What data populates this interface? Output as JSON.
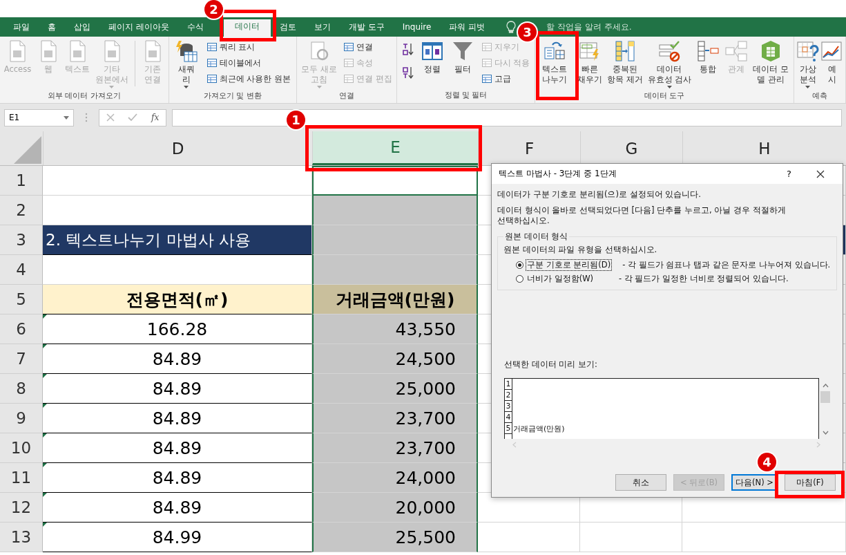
{
  "tabs": [
    {
      "label": "파일",
      "selected": false
    },
    {
      "label": "홈",
      "selected": false
    },
    {
      "label": "삽입",
      "selected": false
    },
    {
      "label": "페이지 레이아웃",
      "selected": false
    },
    {
      "label": "수식",
      "selected": false
    },
    {
      "label": "데이터",
      "selected": true
    },
    {
      "label": "검토",
      "selected": false
    },
    {
      "label": "보기",
      "selected": false
    },
    {
      "label": "개발 도구",
      "selected": false
    },
    {
      "label": "Inquire",
      "selected": false
    },
    {
      "label": "파워 피벗",
      "selected": false
    }
  ],
  "tell_me": "할 작업을 알려 주세요.",
  "ribbon": [
    {
      "label": "외부 데이터 가져오기",
      "items": [
        {
          "kind": "big",
          "lines": [
            "Access"
          ],
          "disabled": true,
          "dropdown": false
        },
        {
          "kind": "big",
          "lines": [
            "웹"
          ],
          "disabled": true,
          "dropdown": false
        },
        {
          "kind": "big",
          "lines": [
            "텍스트"
          ],
          "disabled": true,
          "dropdown": false
        },
        {
          "kind": "big",
          "lines": [
            "기타",
            "원본에서"
          ],
          "disabled": true,
          "dropdown": true
        },
        {
          "kind": "divider"
        },
        {
          "kind": "big",
          "lines": [
            "기존",
            "연결"
          ],
          "disabled": true,
          "dropdown": false
        }
      ]
    },
    {
      "label": "가져오기 및 변환",
      "items": [
        {
          "kind": "big",
          "lines": [
            "새쿼",
            "리"
          ],
          "disabled": false,
          "dropdown": true
        },
        {
          "kind": "stack",
          "items": [
            {
              "label": "쿼리 표시",
              "disabled": false
            },
            {
              "label": "테이블에서",
              "disabled": false
            },
            {
              "label": "최근에 사용한 원본",
              "disabled": false
            }
          ]
        }
      ]
    },
    {
      "label": "연결",
      "items": [
        {
          "kind": "big",
          "lines": [
            "모두 새로",
            "고침"
          ],
          "disabled": true,
          "dropdown": true
        },
        {
          "kind": "stack",
          "items": [
            {
              "label": "연결",
              "disabled": false
            },
            {
              "label": "속성",
              "disabled": true
            },
            {
              "label": "연결 편집",
              "disabled": true
            }
          ]
        }
      ]
    },
    {
      "label": "정렬 및 필터",
      "items": [
        {
          "kind": "sort"
        },
        {
          "kind": "big",
          "lines": [
            "정렬"
          ],
          "disabled": false,
          "dropdown": false
        },
        {
          "kind": "big",
          "lines": [
            "필터"
          ],
          "disabled": false,
          "dropdown": false
        },
        {
          "kind": "stack",
          "items": [
            {
              "label": "지우기",
              "disabled": true
            },
            {
              "label": "다시 적용",
              "disabled": true
            },
            {
              "label": "고급",
              "disabled": false
            }
          ]
        }
      ]
    },
    {
      "label": "데이터 도구",
      "items": [
        {
          "kind": "big",
          "lines": [
            "텍스트",
            "나누기"
          ],
          "disabled": false,
          "dropdown": false
        },
        {
          "kind": "big",
          "lines": [
            "빠른",
            "채우기"
          ],
          "disabled": false,
          "dropdown": false
        },
        {
          "kind": "big",
          "lines": [
            "중복된",
            "항목 제거"
          ],
          "disabled": false,
          "dropdown": false
        },
        {
          "kind": "big",
          "lines": [
            "데이터",
            "유효성 검사"
          ],
          "disabled": false,
          "dropdown": true
        },
        {
          "kind": "big",
          "lines": [
            "통합"
          ],
          "disabled": false,
          "dropdown": false
        },
        {
          "kind": "big",
          "lines": [
            "관계"
          ],
          "disabled": true,
          "dropdown": false
        },
        {
          "kind": "big",
          "lines": [
            "데이터 모",
            "델 관리"
          ],
          "disabled": false,
          "dropdown": false
        }
      ]
    },
    {
      "label": "예측",
      "items": [
        {
          "kind": "big",
          "lines": [
            "가상",
            "분석"
          ],
          "disabled": false,
          "dropdown": true
        },
        {
          "kind": "big",
          "lines": [
            "예",
            "시"
          ],
          "disabled": false,
          "dropdown": false
        }
      ]
    }
  ],
  "name_box": "E1",
  "formula_fx": "fx",
  "columns": [
    {
      "label": "D",
      "selected": false
    },
    {
      "label": "E",
      "selected": true
    },
    {
      "label": "F",
      "selected": false
    },
    {
      "label": "G",
      "selected": false
    },
    {
      "label": "H",
      "selected": false
    }
  ],
  "rows": [
    {
      "number": "1",
      "kind": "blank",
      "active": true,
      "selected": true,
      "flag": false
    },
    {
      "number": "2",
      "kind": "blank",
      "active": false,
      "selected": true,
      "flag": false
    },
    {
      "number": "3",
      "kind": "title",
      "d": "2. 텍스트나누기 마법사 사용",
      "active": false,
      "selected": true,
      "flag": false
    },
    {
      "number": "4",
      "kind": "blank",
      "active": false,
      "selected": true,
      "flag": false
    },
    {
      "number": "5",
      "kind": "header",
      "d": "전용면적(㎡)",
      "e": "거래금액(만원)",
      "active": false,
      "selected": true,
      "flag": false
    },
    {
      "number": "6",
      "kind": "data",
      "d": "166.28",
      "e": "43,550",
      "active": false,
      "selected": true,
      "flag": true
    },
    {
      "number": "7",
      "kind": "data",
      "d": "84.89",
      "e": "24,500",
      "active": false,
      "selected": true,
      "flag": true
    },
    {
      "number": "8",
      "kind": "data",
      "d": "84.89",
      "e": "25,000",
      "active": false,
      "selected": true,
      "flag": true
    },
    {
      "number": "9",
      "kind": "data",
      "d": "84.89",
      "e": "23,700",
      "active": false,
      "selected": true,
      "flag": true
    },
    {
      "number": "10",
      "kind": "data",
      "d": "84.89",
      "e": "23,700",
      "active": false,
      "selected": true,
      "flag": true
    },
    {
      "number": "11",
      "kind": "data",
      "d": "84.89",
      "e": "24,000",
      "active": false,
      "selected": true,
      "flag": true
    },
    {
      "number": "12",
      "kind": "data",
      "d": "84.89",
      "e": "20,000",
      "active": false,
      "selected": true,
      "flag": true
    },
    {
      "number": "13",
      "kind": "data",
      "d": "84.99",
      "e": "25,500",
      "active": false,
      "selected": true,
      "flag": true
    }
  ],
  "dialog": {
    "title": "텍스트 마법사 - 3단계 중 1단계",
    "help": "?",
    "message": "데이터가 구분 기호로 분리됨(으)로 설정되어 있습니다.",
    "instruction": "데이터 형식이 올바로 선택되었다면 [다음] 단추를 누르고, 아닐 경우 적절하게 선택하십시오.",
    "group_label": "원본 데이터 형식",
    "prompt": "원본 데이터의 파일 유형을 선택하십시오.",
    "options": [
      {
        "label": "구분 기호로 분리됨(D)",
        "description": "- 각 필드가 쉼표나 탭과 같은 문자로 나누어져 있습니다.",
        "selected": true
      },
      {
        "label": "너비가 일정함(W)",
        "description": "- 각 필드가 일정한 너비로 정렬되어 있습니다.",
        "selected": false
      }
    ],
    "preview_label": "선택한 데이터 미리 보기:",
    "preview_rows": [
      {
        "n": "1"
      },
      {
        "n": "2"
      },
      {
        "n": "3"
      },
      {
        "n": "4"
      },
      {
        "n": "5",
        "text": "거래금액(만원)"
      }
    ],
    "buttons": [
      {
        "label": "취소",
        "kind": "normal",
        "disabled": false
      },
      {
        "label": "< 뒤로(B)",
        "kind": "normal",
        "disabled": true
      },
      {
        "label": "다음(N) >",
        "kind": "default",
        "disabled": false
      },
      {
        "label": "마침(F)",
        "kind": "normal",
        "disabled": false
      }
    ]
  },
  "annotations": [
    "1",
    "2",
    "3",
    "4"
  ]
}
